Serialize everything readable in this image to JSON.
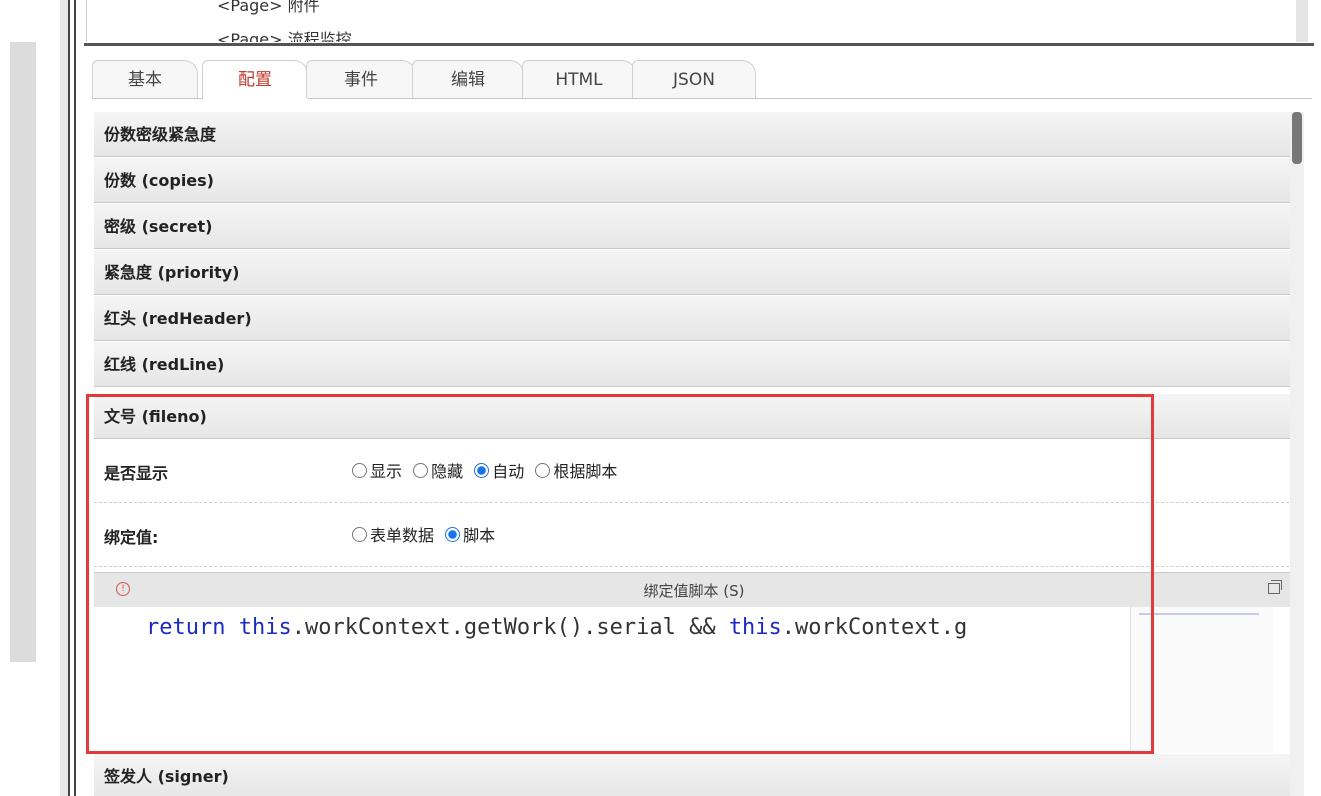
{
  "tree": {
    "line1": "<Page> 附件",
    "line2": "<Page> 流程监控"
  },
  "tabs": [
    {
      "label": "基本"
    },
    {
      "label": "配置"
    },
    {
      "label": "事件"
    },
    {
      "label": "编辑"
    },
    {
      "label": "HTML"
    },
    {
      "label": "JSON"
    }
  ],
  "active_tab": "配置",
  "sections": {
    "group": "份数密级紧急度",
    "copies": "份数 (copies)",
    "secret": "密级 (secret)",
    "priority": "紧急度 (priority)",
    "redHeader": "红头 (redHeader)",
    "redLine": "红线 (redLine)",
    "fileno": "文号 (fileno)",
    "signer": "签发人 (signer)"
  },
  "fileno": {
    "show_label": "是否显示",
    "show_options": [
      "显示",
      "隐藏",
      "自动",
      "根据脚本"
    ],
    "show_selected": "自动",
    "bind_label": "绑定值:",
    "bind_options": [
      "表单数据",
      "脚本"
    ],
    "bind_selected": "脚本",
    "script_title": "绑定值脚本 (S)",
    "code": {
      "kw1": "return",
      "kw2": "this",
      "mid": ".workContext.getWork().serial && ",
      "kw3": "this",
      "tail": ".workContext.g"
    }
  },
  "colors": {
    "active_tab": "#c0392b",
    "keyword": "#1c2bbf",
    "radio_checked": "#1a73e8",
    "highlight": "#e33b3b"
  }
}
